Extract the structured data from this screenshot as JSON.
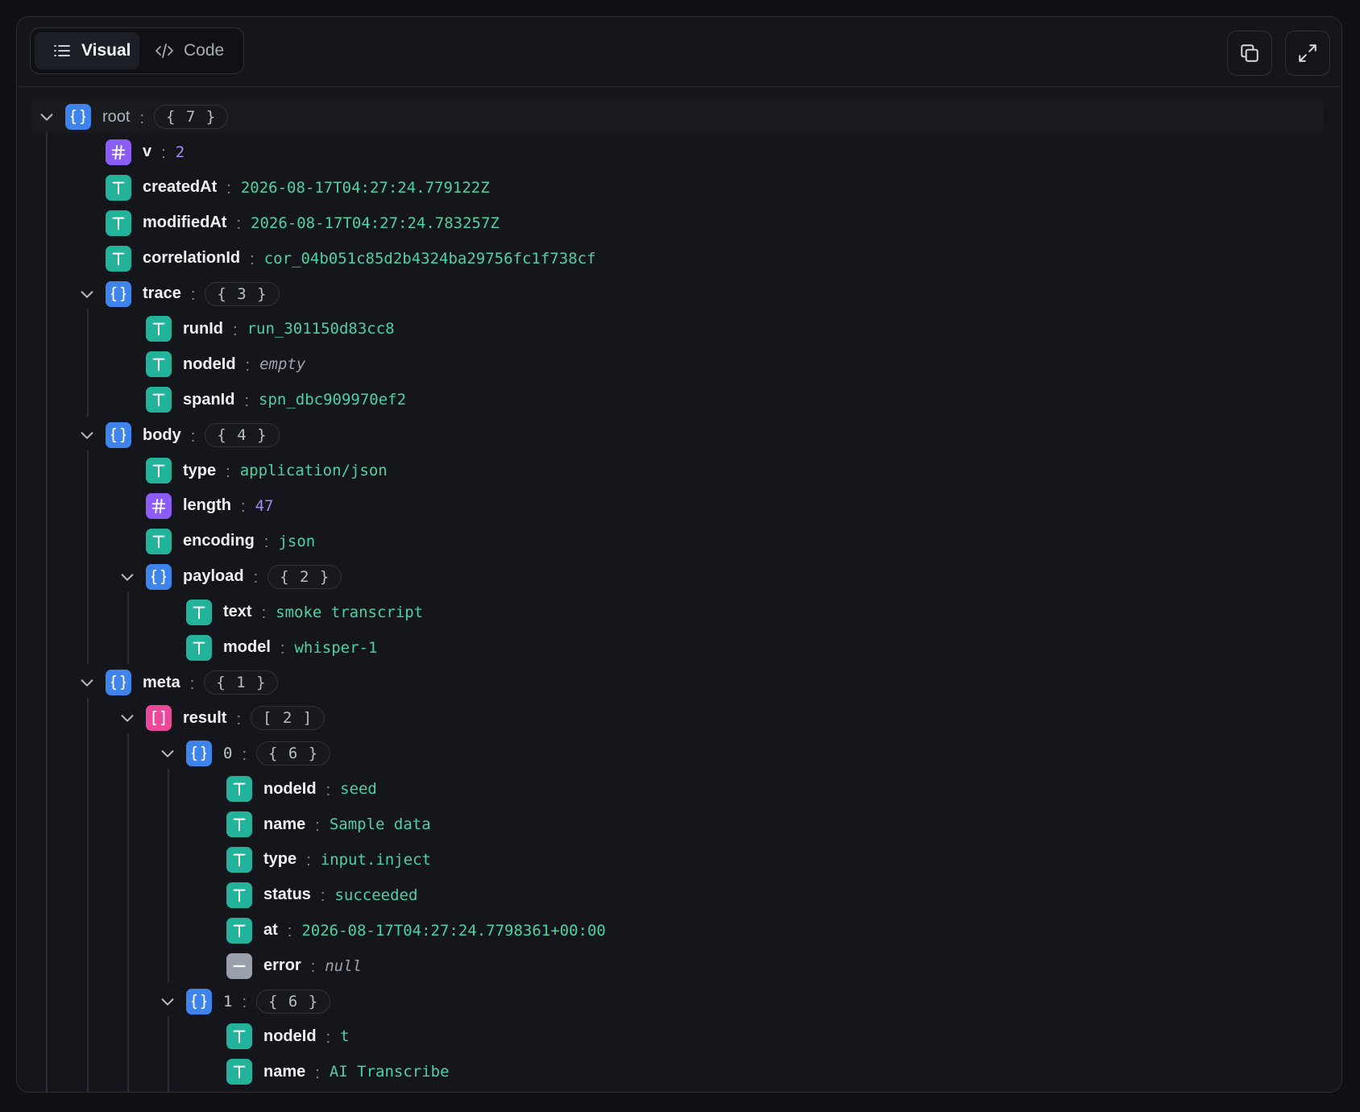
{
  "toolbar": {
    "tabs": [
      {
        "label": "Visual",
        "icon": "list-icon",
        "active": true
      },
      {
        "label": "Code",
        "icon": "code-icon",
        "active": false
      }
    ],
    "actions": [
      {
        "name": "copy",
        "icon": "copy-icon"
      },
      {
        "name": "expand",
        "icon": "expand-icon"
      }
    ]
  },
  "colors": {
    "object": "#3f84ea",
    "number": "#8b5cf6",
    "string": "#22b39a",
    "array": "#ec4899",
    "null": "#9aa0aa",
    "string_value": "#4ed0a2",
    "number_value": "#a48bf8"
  },
  "tree": [
    {
      "key": "root",
      "type": "object",
      "count": "{ 7 }",
      "depth": 0
    },
    {
      "key": "v",
      "type": "number",
      "value": "2",
      "depth": 1
    },
    {
      "key": "createdAt",
      "type": "string",
      "value": "2026-08-17T04:27:24.779122Z",
      "depth": 1
    },
    {
      "key": "modifiedAt",
      "type": "string",
      "value": "2026-08-17T04:27:24.783257Z",
      "depth": 1
    },
    {
      "key": "correlationId",
      "type": "string",
      "value": "cor_04b051c85d2b4324ba29756fc1f738cf",
      "depth": 1
    },
    {
      "key": "trace",
      "type": "object",
      "count": "{ 3 }",
      "depth": 1
    },
    {
      "key": "runId",
      "type": "string",
      "value": "run_301150d83cc8",
      "depth": 2
    },
    {
      "key": "nodeId",
      "type": "string",
      "value": "empty",
      "depth": 2,
      "empty": true
    },
    {
      "key": "spanId",
      "type": "string",
      "value": "spn_dbc909970ef2",
      "depth": 2
    },
    {
      "key": "body",
      "type": "object",
      "count": "{ 4 }",
      "depth": 1
    },
    {
      "key": "type",
      "type": "string",
      "value": "application/json",
      "depth": 2
    },
    {
      "key": "length",
      "type": "number",
      "value": "47",
      "depth": 2
    },
    {
      "key": "encoding",
      "type": "string",
      "value": "json",
      "depth": 2
    },
    {
      "key": "payload",
      "type": "object",
      "count": "{ 2 }",
      "depth": 2
    },
    {
      "key": "text",
      "type": "string",
      "value": "smoke transcript",
      "depth": 3
    },
    {
      "key": "model",
      "type": "string",
      "value": "whisper-1",
      "depth": 3
    },
    {
      "key": "meta",
      "type": "object",
      "count": "{ 1 }",
      "depth": 1
    },
    {
      "key": "result",
      "type": "array",
      "count": "[ 2 ]",
      "depth": 2
    },
    {
      "key": "0",
      "type": "object",
      "count": "{ 6 }",
      "depth": 3,
      "index": true
    },
    {
      "key": "nodeId",
      "type": "string",
      "value": "seed",
      "depth": 4
    },
    {
      "key": "name",
      "type": "string",
      "value": "Sample data",
      "depth": 4
    },
    {
      "key": "type",
      "type": "string",
      "value": "input.inject",
      "depth": 4
    },
    {
      "key": "status",
      "type": "string",
      "value": "succeeded",
      "depth": 4
    },
    {
      "key": "at",
      "type": "string",
      "value": "2026-08-17T04:27:24.7798361+00:00",
      "depth": 4
    },
    {
      "key": "error",
      "type": "null",
      "value": "null",
      "depth": 4
    },
    {
      "key": "1",
      "type": "object",
      "count": "{ 6 }",
      "depth": 3,
      "index": true
    },
    {
      "key": "nodeId",
      "type": "string",
      "value": "t",
      "depth": 4
    },
    {
      "key": "name",
      "type": "string",
      "value": "AI Transcribe",
      "depth": 4
    }
  ]
}
